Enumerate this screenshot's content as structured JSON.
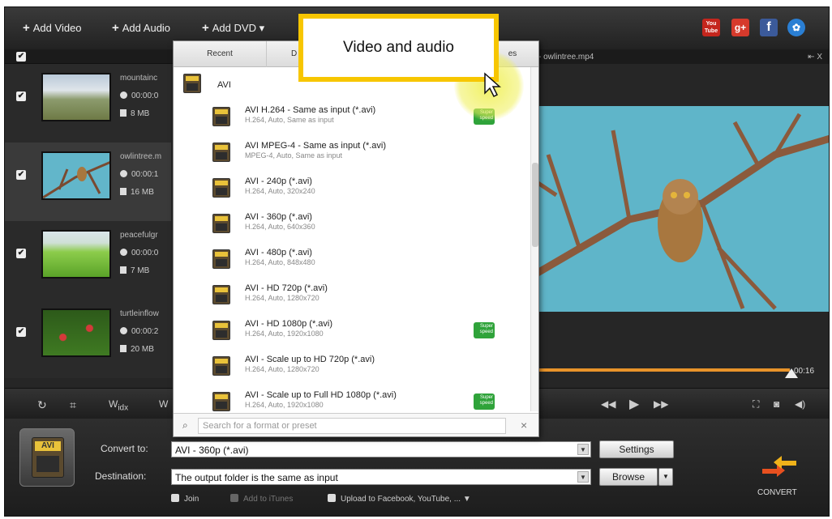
{
  "toolbar": {
    "add_video": "Add Video",
    "add_audio": "Add Audio",
    "add_dvd": "Add DVD"
  },
  "social": {
    "youtube": "You Tube",
    "gplus": "g+",
    "facebook": "f"
  },
  "files": [
    {
      "name": "mountainc",
      "duration": "00:00:0",
      "size": "8 MB"
    },
    {
      "name": "owlintree.m",
      "duration": "00:00:1",
      "size": "16 MB"
    },
    {
      "name": "peacefulgr",
      "duration": "00:00:0",
      "size": "7 MB"
    },
    {
      "name": "turtleinflow",
      "duration": "00:00:2",
      "size": "20 MB"
    }
  ],
  "preview": {
    "filename": "- owlintree.mp4",
    "close": "⇤ X",
    "time": "00:16"
  },
  "dropdown": {
    "tabs": [
      "Recent",
      "D",
      "es"
    ],
    "category": "AVI",
    "items": [
      {
        "name": "AVI H.264 - Same as input (*.avi)",
        "sub": "H.264, Auto, Same as input",
        "superspeed": true
      },
      {
        "name": "AVI MPEG-4 - Same as input (*.avi)",
        "sub": "MPEG-4, Auto, Same as input",
        "superspeed": false
      },
      {
        "name": "AVI - 240p (*.avi)",
        "sub": "H.264, Auto, 320x240",
        "superspeed": false
      },
      {
        "name": "AVI - 360p (*.avi)",
        "sub": "H.264, Auto, 640x360",
        "superspeed": false
      },
      {
        "name": "AVI - 480p (*.avi)",
        "sub": "H.264, Auto, 848x480",
        "superspeed": false
      },
      {
        "name": "AVI - HD 720p (*.avi)",
        "sub": "H.264, Auto, 1280x720",
        "superspeed": false
      },
      {
        "name": "AVI - HD 1080p (*.avi)",
        "sub": "H.264, Auto, 1920x1080",
        "superspeed": true
      },
      {
        "name": "AVI - Scale up to HD 720p (*.avi)",
        "sub": "H.264, Auto, 1280x720",
        "superspeed": false
      },
      {
        "name": "AVI - Scale up to Full HD 1080p (*.avi)",
        "sub": "H.264, Auto, 1920x1080",
        "superspeed": true
      }
    ],
    "badge": "Super speed",
    "search_placeholder": "Search for a format or preset",
    "clear": "×"
  },
  "callout": "Video and audio",
  "controls": {
    "wide": "W",
    "wide_sub": "idx",
    "wide2": "W"
  },
  "bottom": {
    "convert_to_label": "Convert to:",
    "convert_to_value": "AVI - 360p (*.avi)",
    "settings": "Settings",
    "destination_label": "Destination:",
    "destination_value": "The output folder is the same as input",
    "browse": "Browse",
    "join": "Join",
    "itunes": "Add to iTunes",
    "upload": "Upload to Facebook, YouTube, ...",
    "convert": "CONVERT",
    "format_badge": "AVI"
  }
}
